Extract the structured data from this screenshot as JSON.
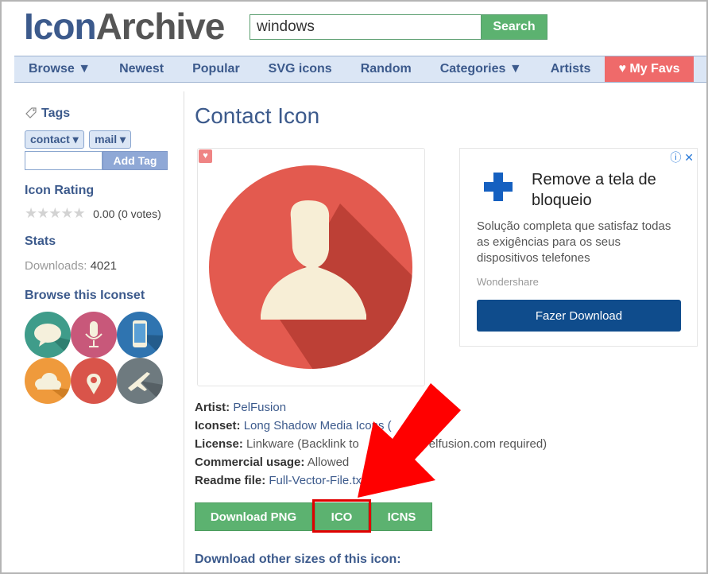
{
  "header": {
    "logo_part1": "Icon",
    "logo_part2": "Archive",
    "search_value": "windows",
    "search_button": "Search"
  },
  "nav": {
    "items": [
      "Browse ▼",
      "Newest",
      "Popular",
      "SVG icons",
      "Random",
      "Categories ▼",
      "Artists"
    ],
    "favs": "♥ My Favs"
  },
  "sidebar": {
    "tags_heading": "Tags",
    "tags": [
      "contact ▾",
      "mail ▾"
    ],
    "add_tag_button": "Add Tag",
    "rating_heading": "Icon Rating",
    "rating_text": "0.00 (0 votes)",
    "stats_heading": "Stats",
    "downloads_label": "Downloads:",
    "downloads_value": "4021",
    "browse_heading": "Browse this Iconset"
  },
  "main": {
    "title": "Contact Icon",
    "meta": {
      "artist_label": "Artist:",
      "artist_value": "PelFusion",
      "iconset_label": "Iconset:",
      "iconset_value": "Long Shadow Media Icons (",
      "license_label": "License:",
      "license_value": "Linkware (Backlink to",
      "license_value2": "elfusion.com required)",
      "commercial_label": "Commercial usage:",
      "commercial_value": "Allowed",
      "readme_label": "Readme file:",
      "readme_value": "Full-Vector-File.tx"
    },
    "buttons": {
      "png": "Download PNG",
      "ico": "ICO",
      "icns": "ICNS"
    },
    "other_sizes": "Download other sizes of this icon:"
  },
  "ad": {
    "info": "ⓘ ✕",
    "headline": "Remove a tela de bloqueio",
    "body": "Solução completa que satisfaz todas as exigências para os seus dispositivos telefones",
    "brand": "Wondershare",
    "button": "Fazer Download"
  },
  "colors": {
    "brand_blue": "#3c5a8c",
    "green": "#5cb270",
    "fav_red": "#ef6a6a",
    "highlight_red": "#e00000"
  }
}
